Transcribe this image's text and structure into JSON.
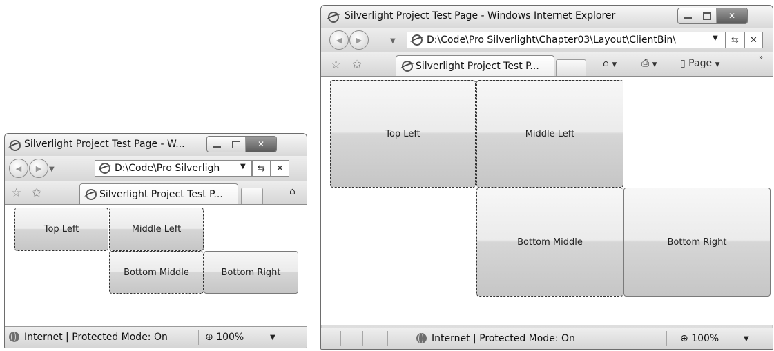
{
  "small_window": {
    "title": "Silverlight Project Test Page - W...",
    "address": "D:\\Code\\Pro Silverligh",
    "tab_label": "Silverlight Project Test P...",
    "cells": [
      "Top Left",
      "Middle Left",
      "Bottom Middle",
      "Bottom Right"
    ],
    "status": "Internet | Protected Mode: On",
    "zoom": "100%"
  },
  "large_window": {
    "title": "Silverlight Project Test Page - Windows Internet Explorer",
    "address": "D:\\Code\\Pro Silverlight\\Chapter03\\Layout\\ClientBin\\",
    "tab_label": "Silverlight Project Test P...",
    "page_menu": "Page",
    "cells": [
      "Top Left",
      "Middle Left",
      "Bottom Middle",
      "Bottom Right"
    ],
    "status": "Internet | Protected Mode: On",
    "zoom": "100%"
  },
  "icons": [
    "ie-icon",
    "back-icon",
    "forward-icon",
    "refresh-icon",
    "stop-icon",
    "favorites-star-icon",
    "add-favorites-icon",
    "home-icon",
    "print-icon",
    "page-icon",
    "globe-icon",
    "zoom-icon",
    "minimize-icon",
    "maximize-icon",
    "close-icon"
  ]
}
